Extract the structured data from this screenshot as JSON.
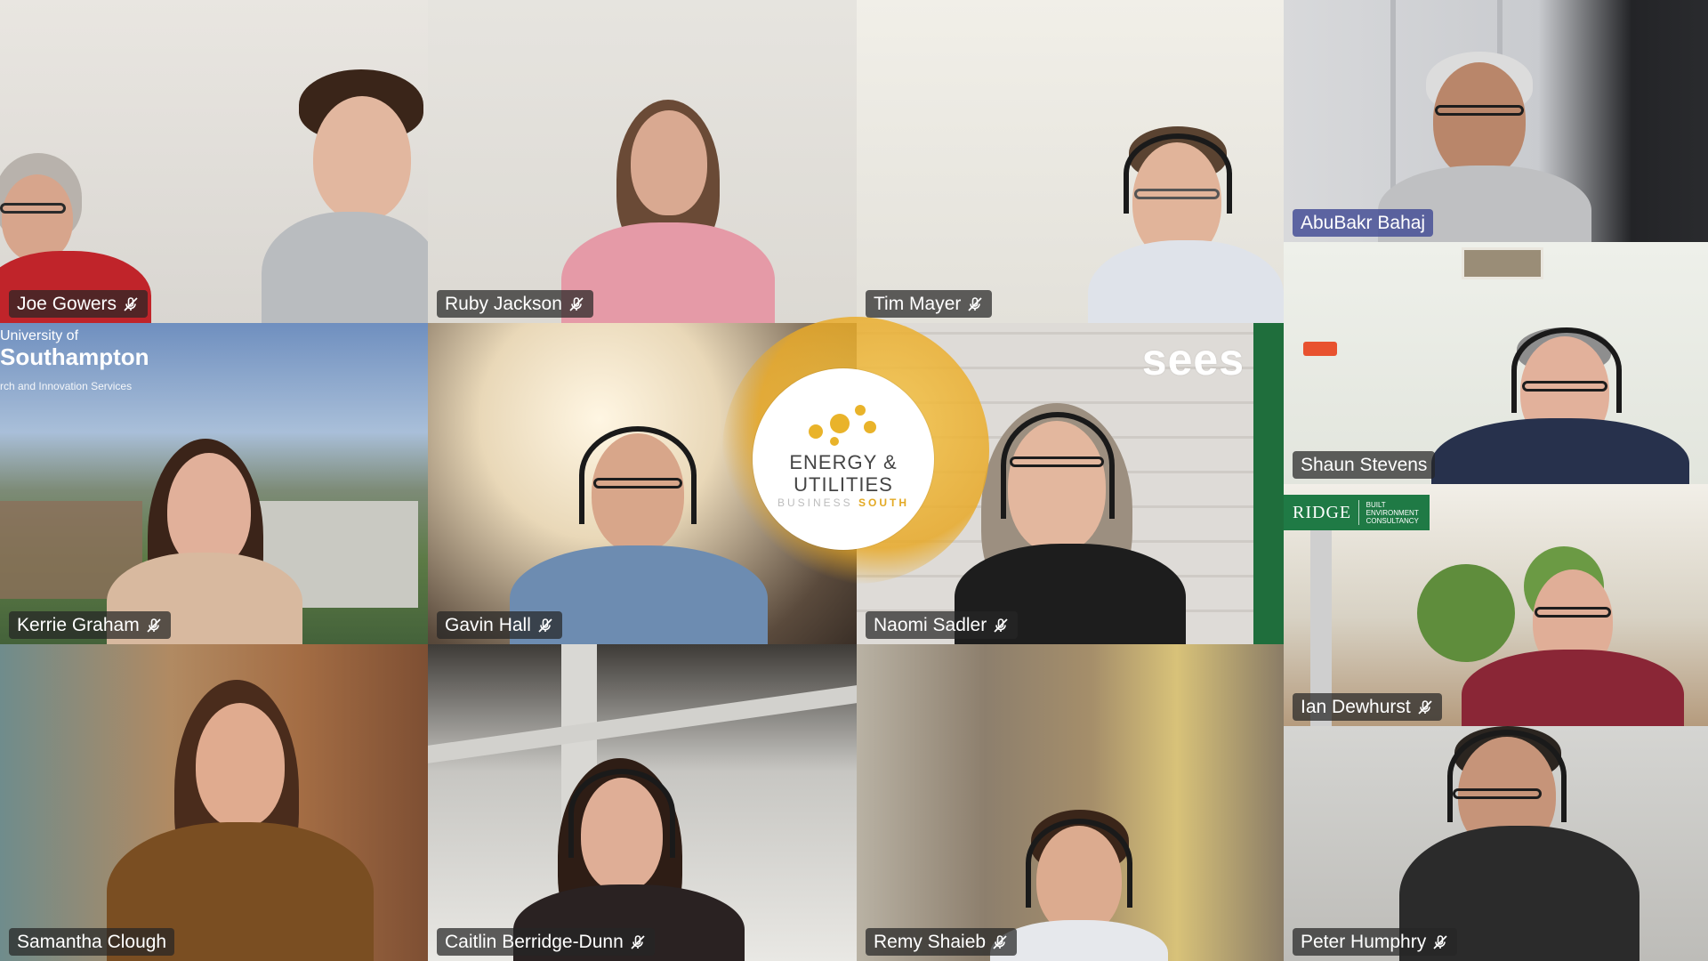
{
  "meeting": {
    "participants": [
      {
        "id": "joe",
        "name": "Joe Gowers",
        "muted": true
      },
      {
        "id": "ruby",
        "name": "Ruby Jackson",
        "muted": true
      },
      {
        "id": "tim",
        "name": "Tim Mayer",
        "muted": true
      },
      {
        "id": "abubakr",
        "name": "AbuBakr Bahaj",
        "muted": false,
        "speaking": true
      },
      {
        "id": "shaun",
        "name": "Shaun Stevens",
        "muted": false
      },
      {
        "id": "kerrie",
        "name": "Kerrie Graham",
        "muted": true
      },
      {
        "id": "gavin",
        "name": "Gavin Hall",
        "muted": true
      },
      {
        "id": "naomi",
        "name": "Naomi Sadler",
        "muted": true
      },
      {
        "id": "ian",
        "name": "Ian Dewhurst",
        "muted": true
      },
      {
        "id": "samantha",
        "name": "Samantha Clough",
        "muted": false
      },
      {
        "id": "caitlin",
        "name": "Caitlin Berridge-Dunn",
        "muted": true
      },
      {
        "id": "remy",
        "name": "Remy Shaieb",
        "muted": true
      },
      {
        "id": "peter",
        "name": "Peter Humphry",
        "muted": true
      }
    ]
  },
  "backgrounds": {
    "southampton": {
      "line1": "University of",
      "line2": "Southampton",
      "line3": "rch and Innovation Services"
    },
    "sees": {
      "text": "sees"
    },
    "ridge": {
      "brand": "RIDGE",
      "tagline": "BUILT ENVIRONMENT CONSULTANCY"
    }
  },
  "center_logo": {
    "line1": "ENERGY &",
    "line2": "UTILITIES",
    "line3a": "BUSINESS",
    "line3b": "SOUTH"
  },
  "colors": {
    "gold": "#e9b32a",
    "ridge_green": "#1f7a45",
    "name_tag_bg": "#262626",
    "speaking_tag_bg": "#4650a0"
  },
  "icons": {
    "mute": "mic-off-icon"
  }
}
